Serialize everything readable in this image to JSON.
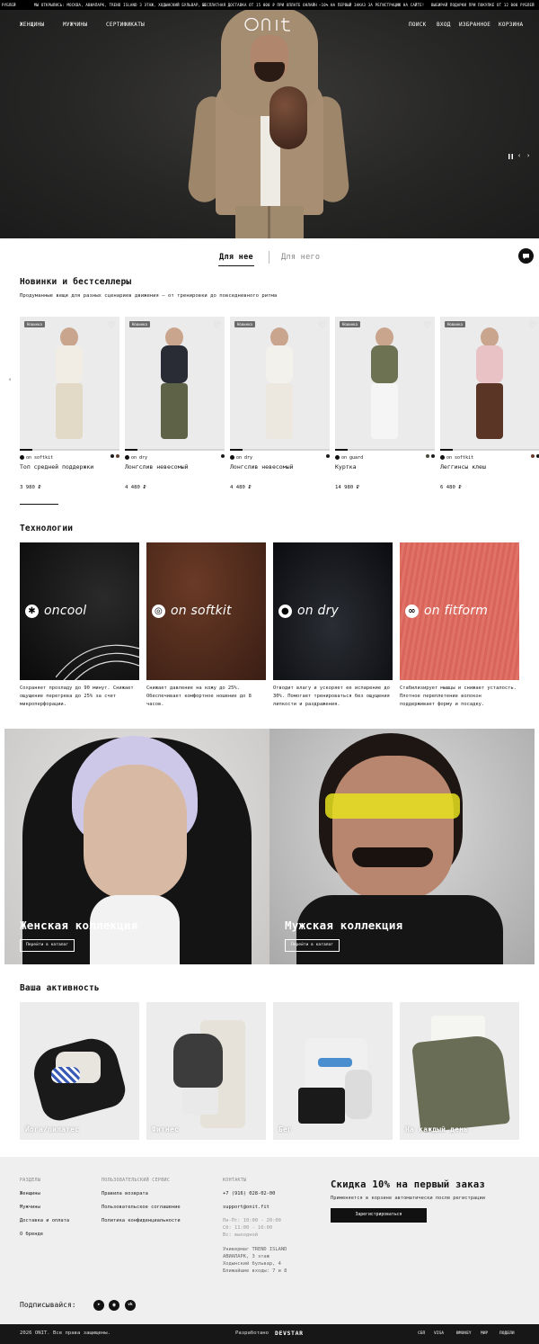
{
  "ticker": {
    "currency": "РУБЛЕЙ",
    "store": "МЫ ОТКРЫЛИСЬ: МОСКВА, АВИАПАРК, TREND ISLAND 3 ЭТАЖ, ХОДЫНСКИЙ БУЛЬВАР, 4",
    "delivery": "БЕСПЛАТНАЯ ДОСТАВКА ОТ 15 000 ₽ ПРИ ОПЛАТЕ ОНЛАЙН",
    "promo": "−10% НА ПЕРВЫЙ ЗАКАЗ ЗА РЕГИСТРАЦИЮ НА САЙТЕ!",
    "gifts": "ВЫБИРАЙ ПОДАРКИ ПРИ ПОКУПКЕ ОТ 12 000 РУБЛЕЙ"
  },
  "header": {
    "logo": "onit",
    "nav_left": [
      "Женщины",
      "Мужчины",
      "Сертификаты"
    ],
    "nav_right": [
      "Поиск",
      "Вход",
      "Избранное",
      "Корзина"
    ]
  },
  "hero": {
    "pause_icon": "pause-icon",
    "prev": "‹",
    "next": "›"
  },
  "tabs": [
    "Для нее",
    "Для него"
  ],
  "new": {
    "title": "Новинки и бестселлеры",
    "subtitle": "Продуманные вещи для разных сценариев движения — от тренировки до повседневного ритма",
    "badge": "Новинка",
    "products": [
      {
        "tech": "on softkit",
        "name": "Топ средней поддержки",
        "price": "3 980 ₽",
        "colors": [
          "#1a1a1a",
          "#5a4030"
        ]
      },
      {
        "tech": "on dry",
        "name": "Лонгслив невесомый",
        "price": "4 480 ₽",
        "colors": [
          "#1a1a1a"
        ]
      },
      {
        "tech": "on dry",
        "name": "Лонгслив невесомый",
        "price": "4 480 ₽",
        "colors": [
          "#1a1a1a"
        ]
      },
      {
        "tech": "on guard",
        "name": "Куртка",
        "price": "14 980 ₽",
        "colors": [
          "#4a4a3a",
          "#1a1a1a"
        ]
      },
      {
        "tech": "on softkit",
        "name": "Леггинсы клеш",
        "price": "6 480 ₽",
        "colors": [
          "#6a3a2a",
          "#1a1a1a"
        ]
      }
    ]
  },
  "tech": {
    "title": "Технологии",
    "items": [
      {
        "name": "oncool",
        "desc": "Сохраняет прохладу до 90 минут. Снижает ощущение перегрева до 25% за счет микроперфорации."
      },
      {
        "name": "on softkit",
        "desc": "Снижает давление на кожу до 25%. Обеспечивает комфортное ношение до 8 часов."
      },
      {
        "name": "on dry",
        "desc": "Отводит влагу и ускоряет ее испарение до 30%. Помогает тренироваться без ощущения липкости и раздражения."
      },
      {
        "name": "on fitform",
        "desc": "Стабилизирует мышцы и снижает усталость. Плотное переплетение волокон поддерживает форму и посадку."
      }
    ]
  },
  "collections": [
    {
      "title": "Женская коллекция",
      "button": "Перейти в каталог"
    },
    {
      "title": "Мужская коллекция",
      "button": "Перейти в каталог"
    }
  ],
  "activity": {
    "title": "Ваша активность",
    "items": [
      "Йога/пилатес",
      "Фитнес",
      "Бег",
      "На каждый день"
    ]
  },
  "footer": {
    "sections_title": "Разделы",
    "sections": [
      "Женщины",
      "Мужчины",
      "Доставка и оплата",
      "О бренде"
    ],
    "service_title": "Пользовательский сервис",
    "service": [
      "Правила возврата",
      "Пользовательское соглашение",
      "Политика конфиденциальности"
    ],
    "contacts_title": "Контакты",
    "phone": "+7 (916) 028-02-00",
    "email": "support@onit.fit",
    "hours": [
      "Пн-Пт: 10:00 - 20:00",
      "Сб: 11:00 - 16:00",
      "Вс: выходной"
    ],
    "address": [
      "Универмаг TREND ISLAND",
      "АВИАПАРК, 3 этаж",
      "Ходынский бульвар, 4",
      "Ближайшие входы: 7 и 8"
    ],
    "promo_title": "Скидка 10% на первый заказ",
    "promo_sub": "Применяется в корзине автоматически после регистрации",
    "promo_button": "Зарегистрироваться",
    "subscribe": "Подписывайся:",
    "social_icons": [
      "telegram-icon",
      "max-icon",
      "vk-icon"
    ]
  },
  "bottom": {
    "copyright": "2026 ONIT. Все права защищены.",
    "dev_label": "Разработано",
    "dev_name": "DEVSTAR",
    "payments": [
      "СБП",
      "VISA",
      "ЮMONEY",
      "МИР",
      "ПОДЕЛИ"
    ]
  },
  "colors": {
    "accent": "#111111",
    "footer_bg": "#efefef",
    "bottom_bg": "#171717",
    "badge": "#6a6a6a"
  }
}
